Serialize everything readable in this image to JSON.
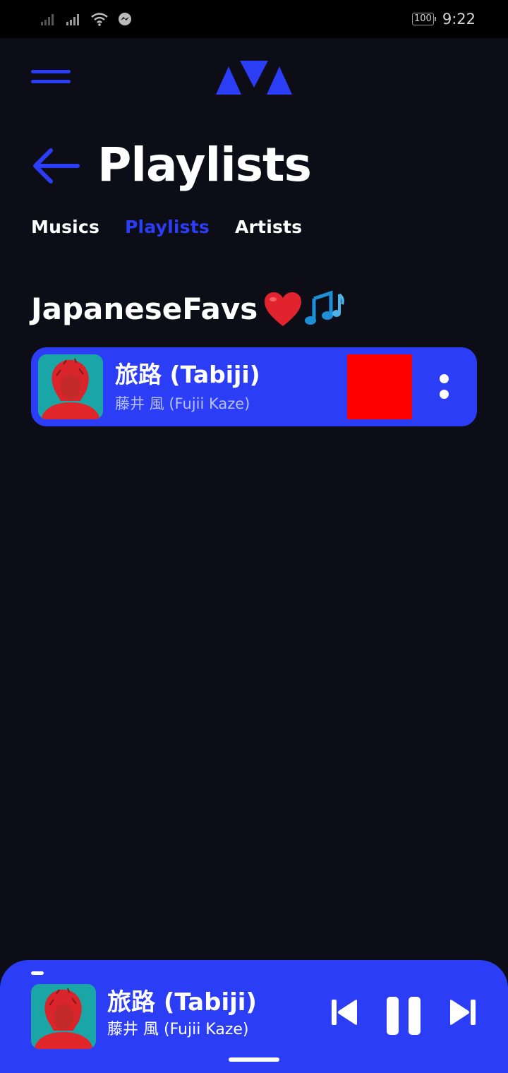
{
  "status_bar": {
    "battery": "100",
    "time": "9:22",
    "icons": [
      "signal-icon",
      "signal-icon",
      "wifi-icon",
      "messenger-icon"
    ]
  },
  "header": {
    "menu_icon": "hamburger-menu-icon",
    "logo_icon": "app-logo-icon",
    "back_icon": "back-arrow-icon",
    "title": "Playlists"
  },
  "tabs": [
    {
      "label": "Musics",
      "active": false
    },
    {
      "label": "Playlists",
      "active": true
    },
    {
      "label": "Artists",
      "active": false
    }
  ],
  "playlist": {
    "name": "JapaneseFavs",
    "emoji_icons": [
      "heart-icon",
      "music-notes-icon"
    ],
    "tracks": [
      {
        "title": "旅路 (Tabiji)",
        "artist": "藤井 風 (Fujii Kaze)",
        "art_icon": "album-art",
        "more_icon": "more-vertical-icon"
      }
    ]
  },
  "now_playing": {
    "title": "旅路 (Tabiji)",
    "artist": "藤井 風 (Fujii Kaze)",
    "controls": [
      "previous-icon",
      "pause-icon",
      "next-icon"
    ]
  },
  "colors": {
    "background": "#0c0d16",
    "accent": "#2b3df5",
    "status_bar": "#000000",
    "red_box": "#ff0000",
    "album_teal": "#1aa6a6",
    "album_red": "#e0262b"
  }
}
